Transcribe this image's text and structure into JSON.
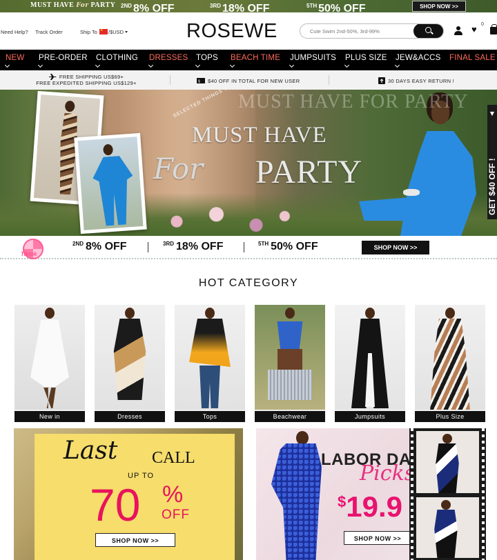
{
  "promo_strip": {
    "left_text": "MUST HAVE",
    "left_script": "For",
    "left_end": "PARTY",
    "deals": [
      {
        "sup": "2ND",
        "text": "8% OFF"
      },
      {
        "sup": "3RD",
        "text": "18% OFF"
      },
      {
        "sup": "5TH",
        "text": "50% OFF"
      }
    ],
    "shop_label": "SHOP NOW >>"
  },
  "header": {
    "need_help": "Need Help?",
    "track_order": "Track Order",
    "ship_to": "Ship To",
    "currency": "/$USD",
    "logo": "ROSEWE",
    "search_placeholder": "Cute Swim 2nd-50%, 3rd-99%",
    "wishlist_count": "0"
  },
  "nav": {
    "items": [
      {
        "label": "NEW",
        "red": true
      },
      {
        "label": "PRE-ORDER",
        "red": false
      },
      {
        "label": "CLOTHING",
        "red": false
      },
      {
        "label": "DRESSES",
        "red": true
      },
      {
        "label": "TOPS",
        "red": false
      },
      {
        "label": "BEACH TIME",
        "red": true
      },
      {
        "label": "JUMPSUITS",
        "red": false
      },
      {
        "label": "PLUS SIZE",
        "red": false
      },
      {
        "label": "JEW&ACCS",
        "red": false
      },
      {
        "label": "FINAL SALE",
        "red": true
      }
    ]
  },
  "benefits": {
    "shipping_line1": "FREE SHIPPING US$69+",
    "shipping_line2": "FREE EXPEDITED SHIPPING US$129+",
    "coupon": "$40 OFF IN TOTAL FOR NEW USER",
    "returns": "30 DAYS EASY RETURN !"
  },
  "hero": {
    "eyebrow": "SELECTED THINGS ONLY",
    "watermark": "MUST HAVE FOR PARTY",
    "line1": "MUST HAVE",
    "script": "For",
    "line2": "PARTY",
    "side_tab": "GET $40 OFF !"
  },
  "coupon_strip": {
    "wheel_label": "Tiktok",
    "deals": [
      {
        "sup": "2ND",
        "text": "8% OFF"
      },
      {
        "sup": "3RD",
        "text": "18% OFF"
      },
      {
        "sup": "5TH",
        "text": "50% OFF"
      }
    ],
    "shop_label": "SHOP NOW >>"
  },
  "hot_category": {
    "title": "HOT CATEGORY",
    "items": [
      {
        "label": "New in"
      },
      {
        "label": "Dresses"
      },
      {
        "label": "Tops"
      },
      {
        "label": "Beachwear"
      },
      {
        "label": "Jumpsuits"
      },
      {
        "label": "Plus Size"
      }
    ]
  },
  "banner_left": {
    "last": "Last",
    "call": "CALL",
    "up_to": "UP TO",
    "number": "70",
    "percent": "%",
    "off": "OFF",
    "shop_label": "SHOP NOW >>"
  },
  "banner_right": {
    "title": "LABOR DAY",
    "script": "Picks",
    "currency": "$",
    "price": "19.9",
    "shop_label": "SHOP NOW >>"
  },
  "colors": {
    "accent_red": "#ff6b5b",
    "sale_pink": "#e8135c",
    "nav_bg": "#000000"
  }
}
